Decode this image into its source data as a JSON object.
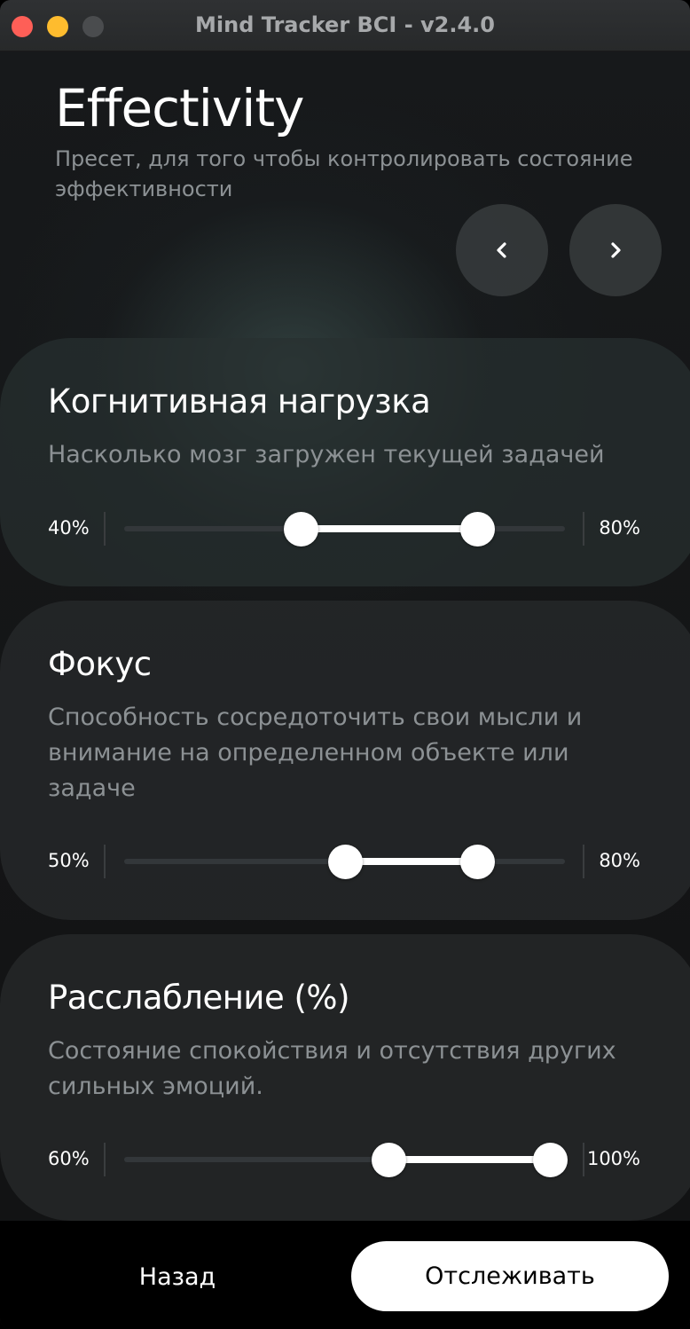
{
  "window": {
    "title": "Mind Tracker BCI - v2.4.0"
  },
  "preset": {
    "name": "Effectivity",
    "description": "Пресет, для того чтобы контролировать состояние эффективности",
    "prev_icon": "chevron-left-icon",
    "next_icon": "chevron-right-icon"
  },
  "metrics": [
    {
      "title": "Когнитивная нагрузка",
      "description": "Насколько мозг загружен текущей задачей",
      "min_label": "40%",
      "max_label": "80%",
      "low": 40,
      "high": 80
    },
    {
      "title": "Фокус",
      "description": "Способность сосредоточить свои мысли и внимание на определенном объекте или задаче",
      "min_label": "50%",
      "max_label": "80%",
      "low": 50,
      "high": 80
    },
    {
      "title": "Расслабление (%)",
      "description": "Состояние спокойствия и отсутствия других сильных эмоций.",
      "min_label": "60%",
      "max_label": "100%",
      "low": 60,
      "high": 100
    }
  ],
  "footer": {
    "back_label": "Назад",
    "track_label": "Отслеживать"
  },
  "colors": {
    "accent": "#ffffff",
    "track": "#33373a",
    "close": "#fe5f57",
    "minimize": "#febc2e"
  }
}
